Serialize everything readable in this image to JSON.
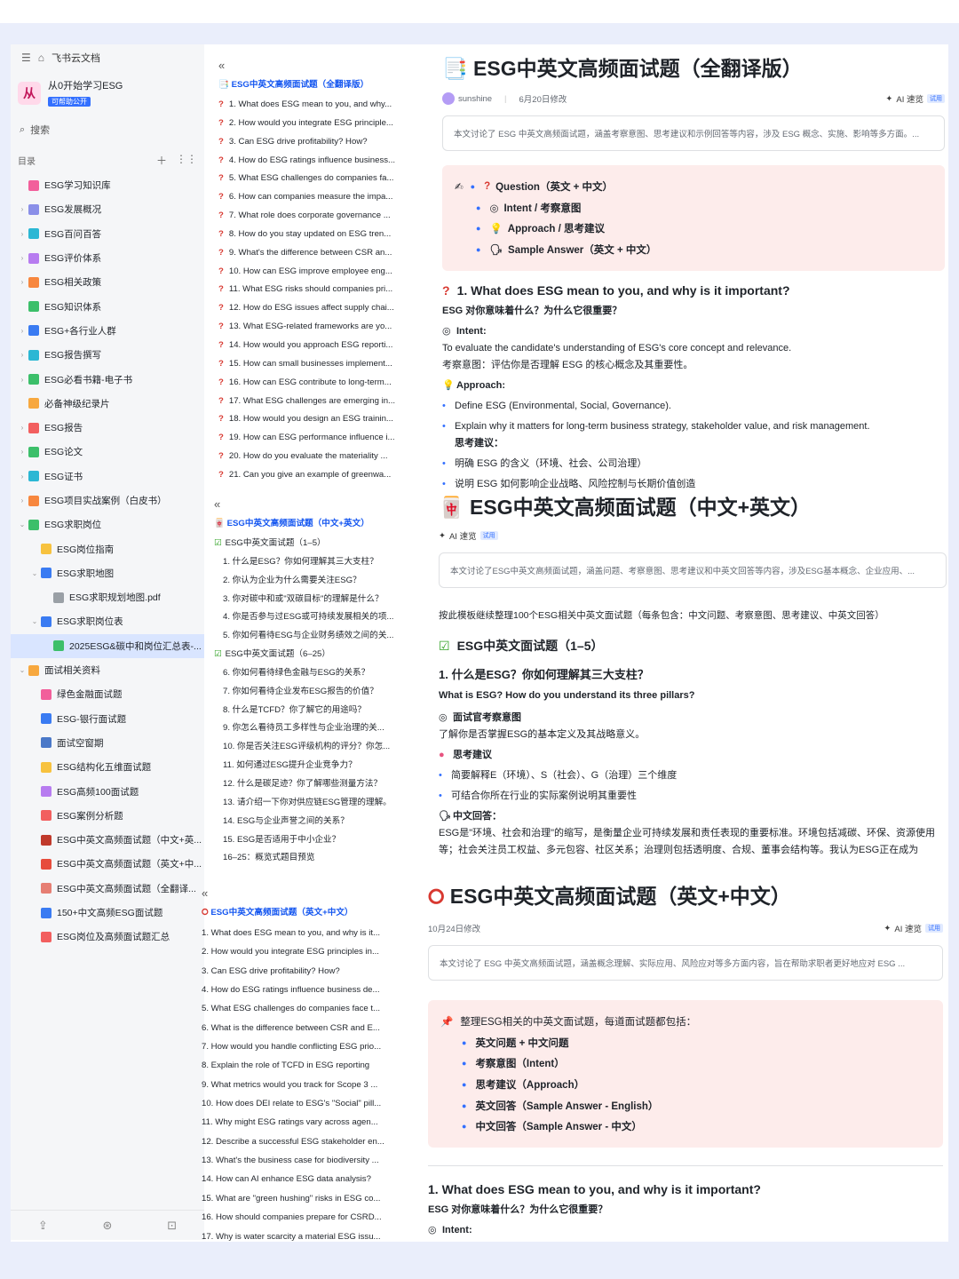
{
  "sidebar": {
    "top_label": "飞书云文档",
    "space_name": "从0开始学习ESG",
    "space_tag": "可帮助公开",
    "search_label": "搜索",
    "dir_label": "目录",
    "items": [
      {
        "label": "ESG学习知识库",
        "color": "#f25f9b",
        "caret": "",
        "indent": 0
      },
      {
        "label": "ESG发展概况",
        "color": "#8a8fe8",
        "caret": "›",
        "indent": 0
      },
      {
        "label": "ESG百问百答",
        "color": "#2bb7d4",
        "caret": "›",
        "indent": 0
      },
      {
        "label": "ESG评价体系",
        "color": "#b77cf0",
        "caret": "›",
        "indent": 0
      },
      {
        "label": "ESG相关政策",
        "color": "#f7873f",
        "caret": "›",
        "indent": 0
      },
      {
        "label": "ESG知识体系",
        "color": "#3cbf6a",
        "caret": "",
        "indent": 0
      },
      {
        "label": "ESG+各行业人群",
        "color": "#3a7bf2",
        "caret": "›",
        "indent": 0
      },
      {
        "label": "ESG报告撰写",
        "color": "#2bb7d4",
        "caret": "›",
        "indent": 0
      },
      {
        "label": "ESG必看书籍-电子书",
        "color": "#3cbf6a",
        "caret": "›",
        "indent": 0
      },
      {
        "label": "必备神级纪录片",
        "color": "#f7a83f",
        "caret": "",
        "indent": 0
      },
      {
        "label": "ESG报告",
        "color": "#f25f5f",
        "caret": "›",
        "indent": 0
      },
      {
        "label": "ESG论文",
        "color": "#3cbf6a",
        "caret": "›",
        "indent": 0
      },
      {
        "label": "ESG证书",
        "color": "#2bb7d4",
        "caret": "›",
        "indent": 0
      },
      {
        "label": "ESG项目实战案例（白皮书）",
        "color": "#f7873f",
        "caret": "›",
        "indent": 0
      },
      {
        "label": "ESG求职岗位",
        "color": "#3cbf6a",
        "caret": "⌄",
        "indent": 0
      },
      {
        "label": "ESG岗位指南",
        "color": "#f7c23f",
        "caret": "",
        "indent": 1
      },
      {
        "label": "ESG求职地图",
        "color": "#3a7bf2",
        "caret": "⌄",
        "indent": 1
      },
      {
        "label": "ESG求职规划地图.pdf",
        "color": "#9aa0a6",
        "caret": "",
        "indent": 2
      },
      {
        "label": "ESG求职岗位表",
        "color": "#3a7bf2",
        "caret": "⌄",
        "indent": 1
      },
      {
        "label": "2025ESG&碳中和岗位汇总表-...",
        "color": "#3cbf6a",
        "caret": "",
        "indent": 2,
        "active": true
      },
      {
        "label": "面试相关资料",
        "color": "#f7a83f",
        "caret": "⌄",
        "indent": 0
      },
      {
        "label": "绿色金融面试题",
        "color": "#f25f9b",
        "caret": "",
        "indent": 1
      },
      {
        "label": "ESG-银行面试题",
        "color": "#3a7bf2",
        "caret": "",
        "indent": 1
      },
      {
        "label": "面试空窗期",
        "color": "#4a78c8",
        "caret": "",
        "indent": 1
      },
      {
        "label": "ESG结构化五维面试题",
        "color": "#f7c23f",
        "caret": "",
        "indent": 1
      },
      {
        "label": "ESG高频100面试题",
        "color": "#b77cf0",
        "caret": "",
        "indent": 1
      },
      {
        "label": "ESG案例分析题",
        "color": "#f25f5f",
        "caret": "",
        "indent": 1
      },
      {
        "label": "ESG中英文高频面试题（中文+英...",
        "color": "#c0392b",
        "caret": "",
        "indent": 1
      },
      {
        "label": "ESG中英文高频面试题（英文+中...",
        "color": "#e74c3c",
        "caret": "",
        "indent": 1
      },
      {
        "label": "ESG中英文高频面试题（全翻译...",
        "color": "#e67e73",
        "caret": "",
        "indent": 1
      },
      {
        "label": "150+中文高频ESG面试题",
        "color": "#3a7bf2",
        "caret": "",
        "indent": 1
      },
      {
        "label": "ESG岗位及高频面试题汇总",
        "color": "#f25f5f",
        "caret": "",
        "indent": 1
      }
    ]
  },
  "toc1": {
    "title": "ESG中英文高频面试题（全翻译版）",
    "items": [
      "1. What does ESG mean to you, and why...",
      "2. How would you integrate ESG principle...",
      "3. Can ESG drive profitability? How?",
      "4. How do ESG ratings influence business...",
      "5. What ESG challenges do companies fa...",
      "6. How can companies measure the impa...",
      "7. What role does corporate governance ...",
      "8. How do you stay updated on ESG tren...",
      "9. What's the difference between CSR an...",
      "10. How can ESG improve employee eng...",
      "11. What ESG risks should companies pri...",
      "12. How do ESG issues affect supply chai...",
      "13. What ESG-related frameworks are yo...",
      "14. How would you approach ESG reporti...",
      "15. How can small businesses implement...",
      "16. How can ESG contribute to long-term...",
      "17. What ESG challenges are emerging in...",
      "18. How would you design an ESG trainin...",
      "19. How can ESG performance influence i...",
      "20. How do you evaluate the materiality ...",
      "21. Can you give an example of greenwa..."
    ]
  },
  "toc2": {
    "title": "ESG中英文高频面试题（中文+英文）",
    "items": [
      {
        "text": "ESG中英文面试题（1–5）",
        "section": true
      },
      {
        "text": "1. 什么是ESG？你如何理解其三大支柱？"
      },
      {
        "text": "2. 你认为企业为什么需要关注ESG？"
      },
      {
        "text": "3. 你对碳中和或\"双碳目标\"的理解是什么？"
      },
      {
        "text": "4. 你是否参与过ESG或可持续发展相关的项..."
      },
      {
        "text": "5. 你如何看待ESG与企业财务绩效之间的关..."
      },
      {
        "text": "ESG中英文面试题（6–25）",
        "section": true
      },
      {
        "text": "6. 你如何看待绿色金融与ESG的关系？"
      },
      {
        "text": "7. 你如何看待企业发布ESG报告的价值？"
      },
      {
        "text": "8. 什么是TCFD？你了解它的用途吗？"
      },
      {
        "text": "9. 你怎么看待员工多样性与企业治理的关..."
      },
      {
        "text": "10. 你是否关注ESG评级机构的评分？你怎..."
      },
      {
        "text": "11. 如何通过ESG提升企业竞争力？"
      },
      {
        "text": "12. 什么是碳足迹？你了解哪些测量方法？"
      },
      {
        "text": "13. 请介绍一下你对供应链ESG管理的理解。"
      },
      {
        "text": "14. ESG与企业声誉之间的关系？"
      },
      {
        "text": "15. ESG是否适用于中小企业？"
      },
      {
        "text": "16–25：概览式题目预览"
      }
    ]
  },
  "toc3": {
    "title": "ESG中英文高频面试题（英文+中文）",
    "items": [
      "1. What does ESG mean to you, and why is it...",
      "2. How would you integrate ESG principles in...",
      "3. Can ESG drive profitability? How?",
      "4. How do ESG ratings influence business de...",
      "5. What ESG challenges do companies face t...",
      "6. What is the difference between CSR and E...",
      "7. How would you handle conflicting ESG prio...",
      "8. Explain the role of TCFD in ESG reporting",
      "9. What metrics would you track for Scope 3 ...",
      "10. How does DEI relate to ESG's \"Social\" pill...",
      "11. Why might ESG ratings vary across agen...",
      "12. Describe a successful ESG stakeholder en...",
      "13. What's the business case for biodiversity ...",
      "14. How can AI enhance ESG data analysis?",
      "15. What are \"green hushing\" risks in ESG co...",
      "16. How should companies prepare for CSRD...",
      "17. Why is water scarcity a material ESG issu..."
    ]
  },
  "doc1": {
    "title": "ESG中英文高频面试题（全翻译版）",
    "author": "sunshine",
    "modified": "6月20日修改",
    "ai_label": "AI 速览",
    "ai_tag": "试用",
    "summary": "本文讨论了 ESG 中英文高频面试题，涵盖考察意图、思考建议和示例回答等内容，涉及 ESG 概念、实施、影响等多方面。...",
    "callout": [
      "Question（英文 + 中文）",
      "Intent / 考察意图",
      "Approach / 思考建议",
      "Sample Answer（英文 + 中文）"
    ],
    "q1_title": "1. What does ESG mean to you, and why is it important?",
    "q1_cn": "ESG 对你意味着什么？为什么它很重要？",
    "intent_label": "Intent:",
    "intent_en": "To evaluate the candidate's understanding of ESG's core concept and relevance.",
    "intent_cn": "考察意图：评估你是否理解 ESG 的核心概念及其重要性。",
    "approach_label": "Approach:",
    "approach_1": "Define ESG (Environmental, Social, Governance).",
    "approach_2": "Explain why it matters for long-term business strategy, stakeholder value, and risk management.",
    "approach_cn_label": "思考建议：",
    "approach_cn_1": "明确 ESG 的含义（环境、社会、公司治理）",
    "approach_cn_2": "说明 ESG 如何影响企业战略、风险控制与长期价值创造"
  },
  "doc2": {
    "title": "ESG中英文高频面试题（中文+英文）",
    "ai_label": "AI 速览",
    "ai_tag": "试用",
    "summary": "本文讨论了ESG中英文高频面试题，涵盖问题、考察意图、思考建议和中英文回答等内容，涉及ESG基本概念、企业应用、...",
    "intro": "按此模板继续整理100个ESG相关中英文面试题（每条包含：中文问题、考察意图、思考建议、中英文回答）",
    "section": "ESG中英文面试题（1–5）",
    "q1": "1. 什么是ESG？你如何理解其三大支柱？",
    "q1_en": "What is ESG? How do you understand its three pillars?",
    "intent_label": "面试官考察意图",
    "intent_text": "了解你是否掌握ESG的基本定义及其战略意义。",
    "approach_label": "思考建议",
    "approach_1": "简要解释E（环境）、S（社会）、G（治理）三个维度",
    "approach_2": "可结合你所在行业的实际案例说明其重要性",
    "answer_label": "中文回答：",
    "answer_text": "ESG是\"环境、社会和治理\"的缩写，是衡量企业可持续发展和责任表现的重要标准。环境包括减碳、环保、资源使用等；社会关注员工权益、多元包容、社区关系；治理则包括透明度、合规、董事会结构等。我认为ESG正在成为"
  },
  "doc3": {
    "title": "ESG中英文高频面试题（英文+中文）",
    "modified": "10月24日修改",
    "ai_label": "AI 速览",
    "ai_tag": "试用",
    "summary": "本文讨论了 ESG 中英文高频面试题，涵盖概念理解、实际应用、风险应对等多方面内容，旨在帮助求职者更好地应对 ESG ...",
    "callout_head": "整理ESG相关的中英文面试题，每道面试题都包括：",
    "callout": [
      "英文问题 + 中文问题",
      "考察意图（Intent）",
      "思考建议（Approach）",
      "英文回答（Sample Answer - English）",
      "中文回答（Sample Answer - 中文）"
    ],
    "q1_title": "1. What does ESG mean to you, and why is it important?",
    "q1_cn": "ESG 对你意味着什么？为什么它很重要？",
    "intent_label": "Intent:"
  }
}
